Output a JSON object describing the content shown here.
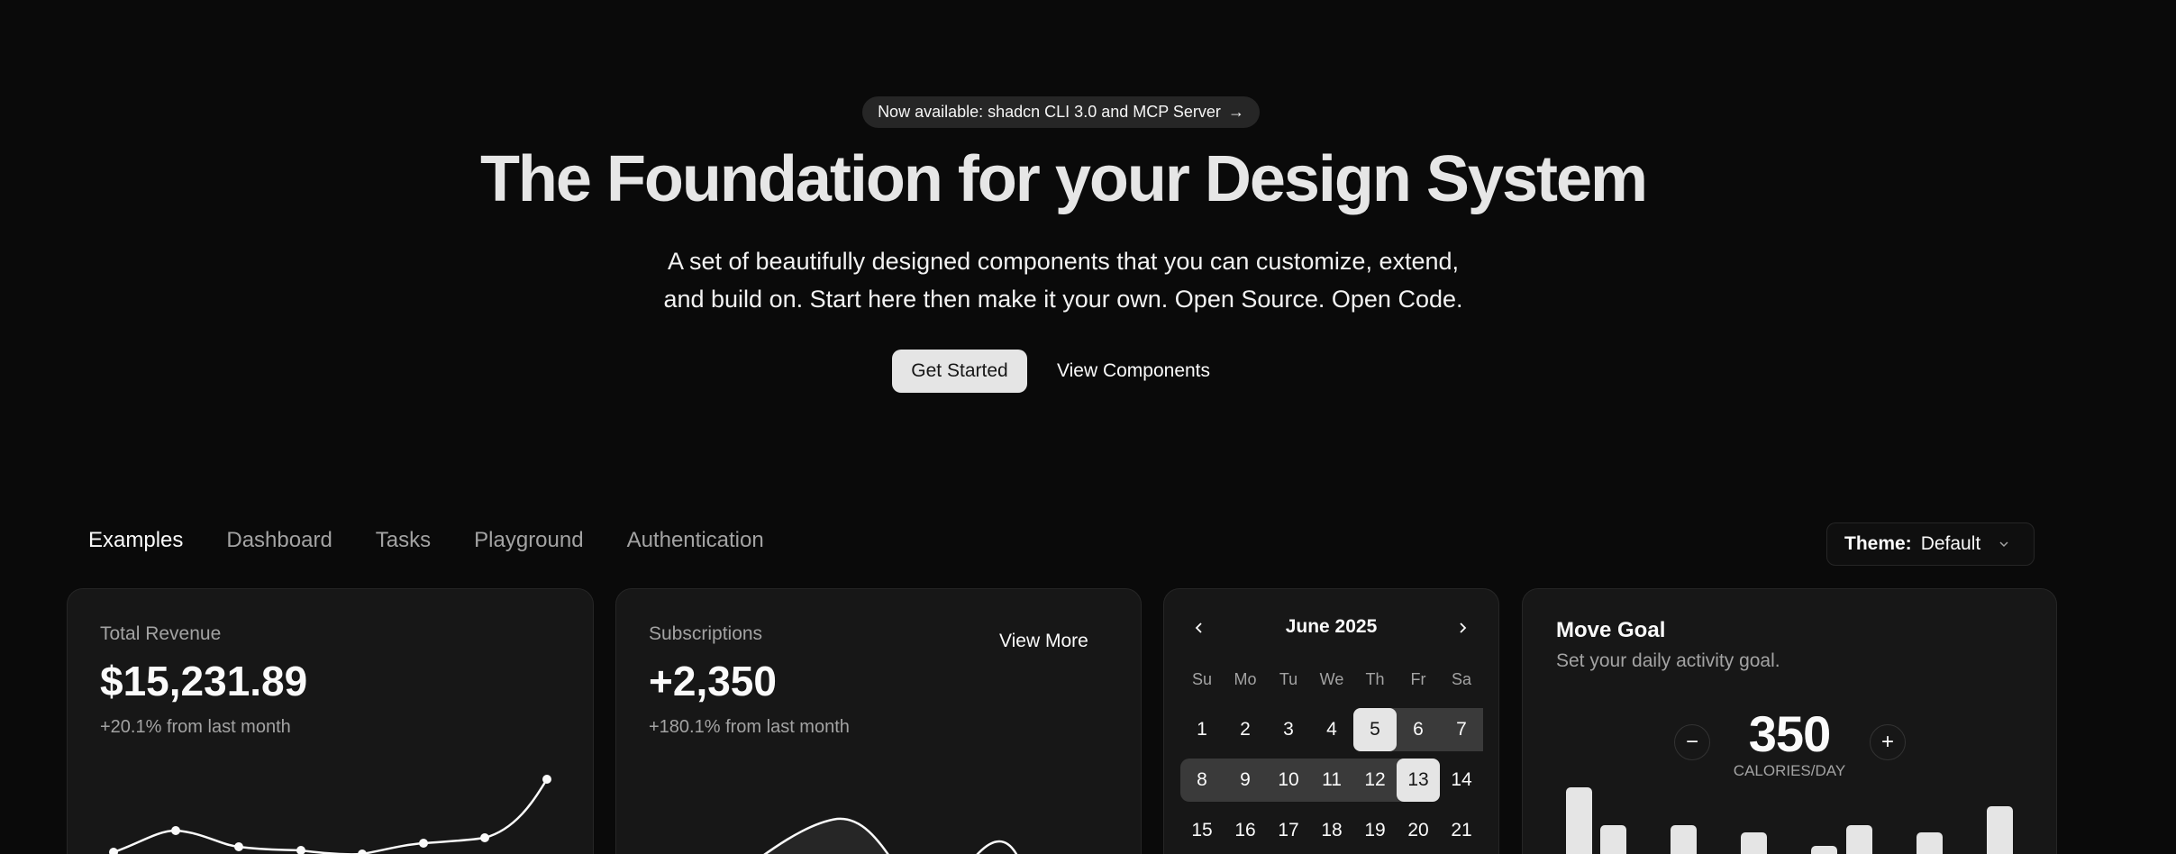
{
  "hero": {
    "announcement": "Now available: shadcn CLI 3.0 and MCP Server",
    "announcement_arrow": "→",
    "title": "The Foundation for your Design System",
    "subtitle_line1": "A set of beautifully designed components that you can customize, extend,",
    "subtitle_line2": "and build on. Start here then make it your own. Open Source. Open Code.",
    "primary_cta": "Get Started",
    "secondary_cta": "View Components"
  },
  "tabs": [
    {
      "label": "Examples",
      "active": true
    },
    {
      "label": "Dashboard",
      "active": false
    },
    {
      "label": "Tasks",
      "active": false
    },
    {
      "label": "Playground",
      "active": false
    },
    {
      "label": "Authentication",
      "active": false
    }
  ],
  "theme": {
    "label": "Theme:",
    "value": "Default"
  },
  "revenue": {
    "label": "Total Revenue",
    "value": "$15,231.89",
    "delta": "+20.1% from last month"
  },
  "subscriptions": {
    "label": "Subscriptions",
    "value": "+2,350",
    "delta": "+180.1% from last month",
    "action": "View More"
  },
  "calendar": {
    "month": "June 2025",
    "weekdays": [
      "Su",
      "Mo",
      "Tu",
      "We",
      "Th",
      "Fr",
      "Sa"
    ],
    "weeks": [
      [
        "1",
        "2",
        "3",
        "4",
        "5",
        "6",
        "7"
      ],
      [
        "8",
        "9",
        "10",
        "11",
        "12",
        "13",
        "14"
      ],
      [
        "15",
        "16",
        "17",
        "18",
        "19",
        "20",
        "21"
      ]
    ],
    "range_start": "5",
    "range_end": "13"
  },
  "move_goal": {
    "title": "Move Goal",
    "description": "Set your daily activity goal.",
    "value": "350",
    "unit": "CALORIES/DAY",
    "minus": "−",
    "plus": "+"
  },
  "colors": {
    "background": "#0a0a0a",
    "card": "#171717",
    "border": "#262626",
    "accent": "#e5e5e5",
    "muted_text": "#a3a3a3"
  }
}
